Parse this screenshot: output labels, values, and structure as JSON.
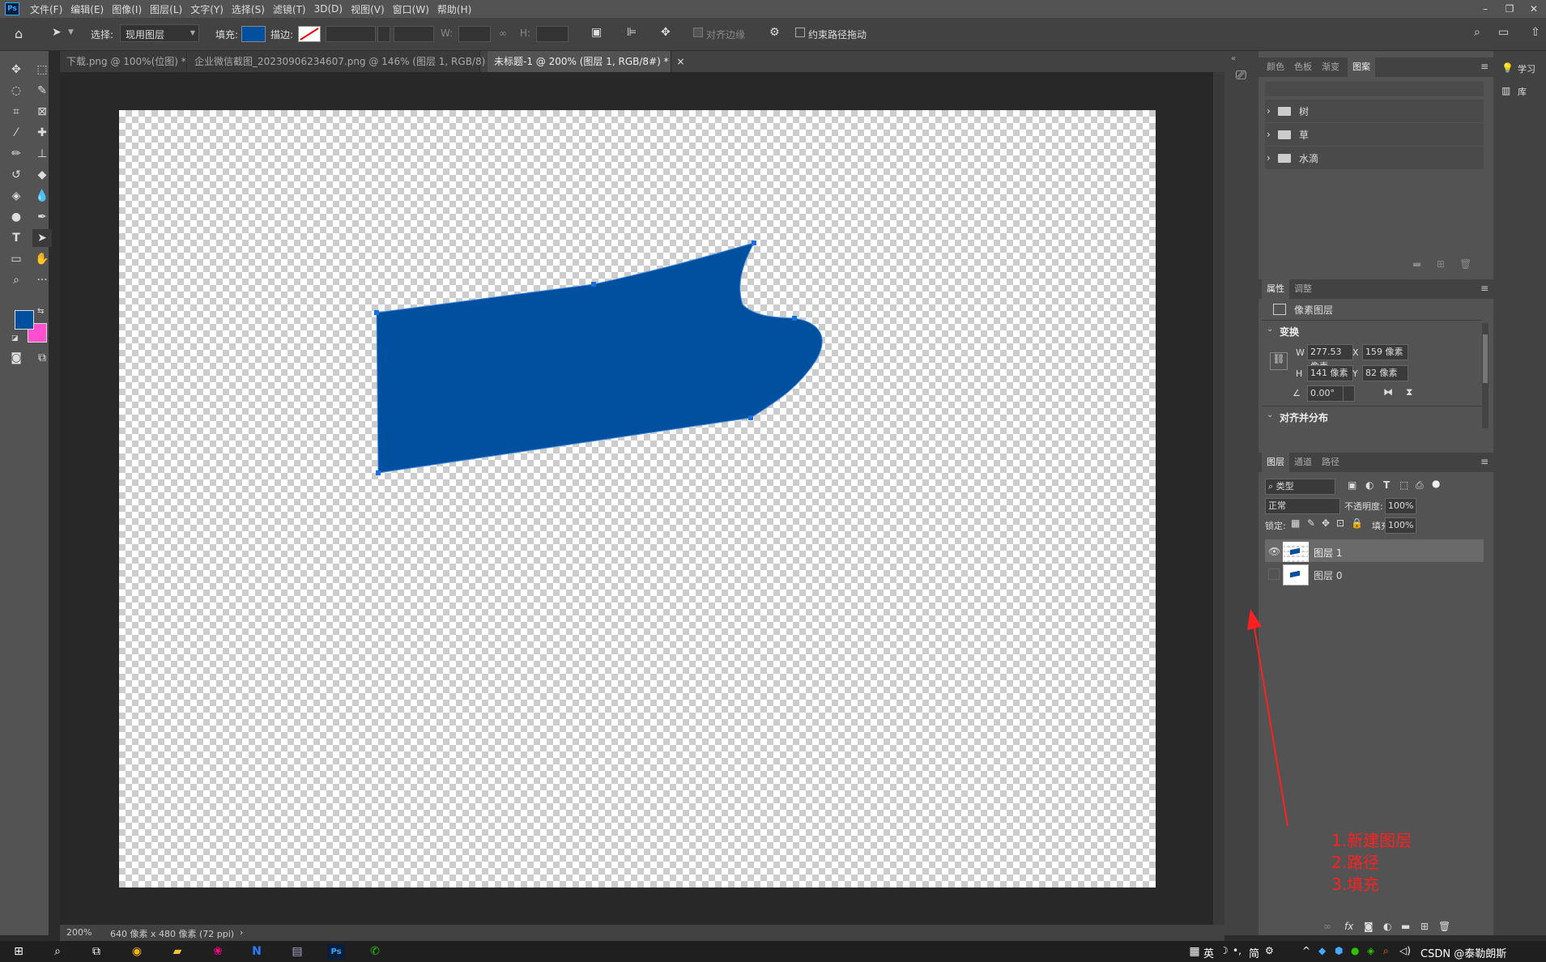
{
  "app": {
    "logo": "Ps",
    "menu": [
      "文件(F)",
      "编辑(E)",
      "图像(I)",
      "图层(L)",
      "文字(Y)",
      "选择(S)",
      "滤镜(T)",
      "3D(D)",
      "视图(V)",
      "窗口(W)",
      "帮助(H)"
    ]
  },
  "options_bar": {
    "select_label": "选择:",
    "select_value": "现用图层",
    "fill_label": "填充:",
    "fill_color": "#0150a0",
    "stroke_label": "描边:",
    "w_label": "W:",
    "h_label": "H:",
    "align_edges_label": "对齐边缘",
    "constrain_path_label": "约束路径拖动"
  },
  "tabs": [
    {
      "label": "下载.png @ 100%(位图) *",
      "active": false
    },
    {
      "label": "企业微信截图_20230906234607.png @ 146% (图层 1, RGB/8)",
      "active": false
    },
    {
      "label": "未标题-1 @ 200% (图层 1, RGB/8#) *",
      "active": true
    }
  ],
  "status_bar": {
    "zoom": "200%",
    "doc_info": "640 像素 x 480 像素 (72 ppi)"
  },
  "colors": {
    "foreground": "#0150a0",
    "background": "#ff4fd0",
    "shape_fill": "#0150a0"
  },
  "swatch_panel": {
    "tabs": [
      "颜色",
      "色板",
      "渐变",
      "图案"
    ],
    "active_tab": "图案",
    "groups": [
      "树",
      "草",
      "水滴"
    ]
  },
  "properties_panel": {
    "tabs": [
      "属性",
      "调整"
    ],
    "active_tab": "属性",
    "kind": "像素图层",
    "transform_title": "变换",
    "w_label": "W",
    "w_value": "277.53 像素",
    "x_label": "X",
    "x_value": "159 像素",
    "h_label": "H",
    "h_value": "141 像素",
    "y_label": "Y",
    "y_value": "82 像素",
    "angle_value": "0.00°",
    "align_title": "对齐并分布"
  },
  "layers_panel": {
    "tabs": [
      "图层",
      "通道",
      "路径"
    ],
    "active_tab": "图层",
    "filter_label": "类型",
    "blend_mode": "正常",
    "opacity_label": "不透明度:",
    "opacity_value": "100%",
    "lock_label": "锁定:",
    "fill_label": "填充:",
    "fill_value": "100%",
    "layers": [
      {
        "name": "图层 1",
        "visible": true,
        "selected": true
      },
      {
        "name": "图层 0",
        "visible": false,
        "selected": false
      }
    ]
  },
  "right_strip": {
    "learn": "学习",
    "library": "库"
  },
  "annotation": {
    "lines": [
      "1.新建图层",
      "2.路径",
      "3.填充"
    ],
    "color": "#ff2020"
  },
  "taskbar": {
    "ime_lang": "英",
    "ime_mode": "简",
    "watermark": "CSDN @泰勒朗斯"
  }
}
